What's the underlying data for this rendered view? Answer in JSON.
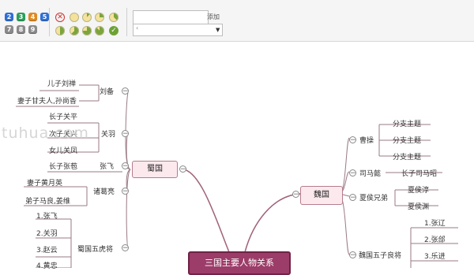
{
  "toolbar": {
    "priority_numbers": [
      "2",
      "3",
      "4",
      "5",
      "7",
      "8",
      "9"
    ],
    "progress_icons": [
      "cancel-icon",
      "pie-0-icon",
      "pie-1-icon",
      "pie-2-icon",
      "pie-3-icon",
      "pie-4-icon",
      "pie-5-icon",
      "pie-6-icon",
      "pie-7-icon",
      "done-icon"
    ],
    "add_label": "添加",
    "input_value": ""
  },
  "watermark": "tuhua.com",
  "map": {
    "center": "三国主要人物关系",
    "shu": {
      "title": "蜀国",
      "liubei": {
        "label": "刘备",
        "children": [
          "儿子刘禅",
          "妻子甘夫人,孙尚香"
        ]
      },
      "guanyu": {
        "label": "关羽",
        "children": [
          "长子关平",
          "次子关兴",
          "女儿关凤"
        ]
      },
      "zhangfei": {
        "label": "张飞",
        "children": [
          "长子张苞"
        ]
      },
      "zhuge": {
        "label": "诸葛亮",
        "children": [
          "妻子黄月英",
          "弟子马良,姜维"
        ]
      },
      "tigers": {
        "label": "蜀国五虎将",
        "children": [
          "1.张飞",
          "2.关羽",
          "3.赵云",
          "4.黄忠"
        ]
      }
    },
    "wei": {
      "title": "魏国",
      "caocao": {
        "label": "曹操",
        "children": [
          "分支主题",
          "分支主题",
          "分支主题"
        ]
      },
      "simayi": {
        "label": "司马懿",
        "children": [
          "长子司马昭"
        ]
      },
      "xiahou": {
        "label": "夏侯兄弟",
        "children": [
          "夏侯淳",
          "夏侯渊"
        ]
      },
      "generals": {
        "label": "魏国五子良将",
        "children": [
          "1.张辽",
          "2.张郃",
          "3.乐进"
        ]
      }
    }
  }
}
